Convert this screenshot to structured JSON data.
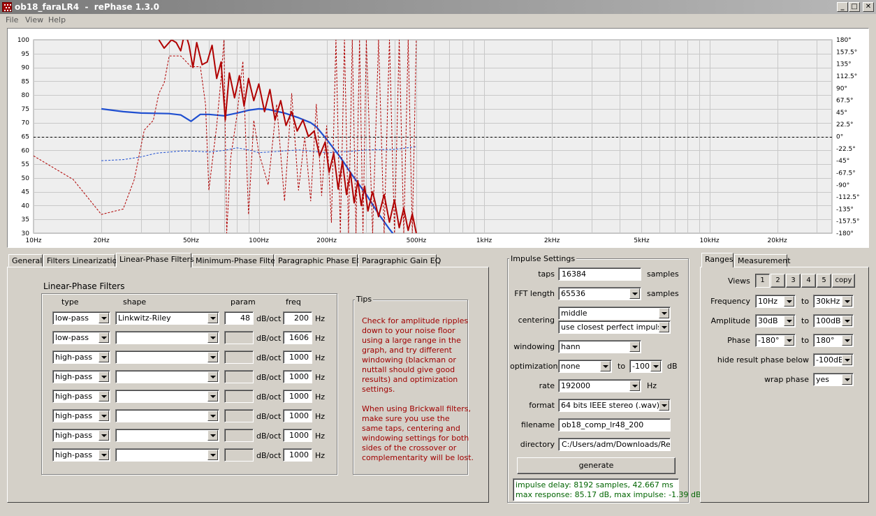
{
  "window": {
    "title": "ob18_faraLR4  -  rePhase 1.3.0",
    "buttons": {
      "minimize": "_",
      "maximize": "□",
      "close": "✕"
    }
  },
  "menu": [
    "File",
    "View",
    "Help"
  ],
  "chart_data": {
    "type": "line",
    "x_scale": "log",
    "xlim": [
      10,
      35000
    ],
    "ylim": [
      30,
      100
    ],
    "y2lim": [
      -180,
      180
    ],
    "x_ticks": [
      {
        "v": 10,
        "label": "10Hz"
      },
      {
        "v": 20,
        "label": "20Hz"
      },
      {
        "v": 50,
        "label": "50Hz"
      },
      {
        "v": 100,
        "label": "100Hz"
      },
      {
        "v": 200,
        "label": "200Hz"
      },
      {
        "v": 500,
        "label": "500Hz"
      },
      {
        "v": 1000,
        "label": "1kHz"
      },
      {
        "v": 2000,
        "label": "2kHz"
      },
      {
        "v": 5000,
        "label": "5kHz"
      },
      {
        "v": 10000,
        "label": "10kHz"
      },
      {
        "v": 20000,
        "label": "20kHz"
      }
    ],
    "y_ticks": [
      100,
      95,
      90,
      85,
      80,
      75,
      70,
      65,
      60,
      55,
      50,
      45,
      40,
      35,
      30
    ],
    "y2_ticks": [
      "180°",
      "157.5°",
      "135°",
      "112.5°",
      "90°",
      "67.5°",
      "45°",
      "22.5°",
      "0°",
      "-22.5°",
      "-45°",
      "-67.5°",
      "-90°",
      "-112.5°",
      "-135°",
      "-157.5°",
      "-180°"
    ],
    "grid": true,
    "colors": {
      "measured": "#b00000",
      "target": "#1f4fd0",
      "zero": "#000000",
      "plot_bg": "#eeeeee"
    },
    "series": [
      {
        "style": "solid-blue",
        "x": [
          20,
          25,
          30,
          35,
          40,
          45,
          50,
          55,
          60,
          70,
          80,
          90,
          100,
          110,
          130,
          150,
          170,
          180,
          200,
          230,
          260,
          300,
          340,
          380,
          420,
          500
        ],
        "y": [
          75,
          74,
          73.5,
          73.4,
          73.3,
          72.8,
          70.5,
          73,
          73,
          72.5,
          73.5,
          74.5,
          75,
          74.8,
          73.5,
          71.8,
          70,
          68.5,
          64,
          57.5,
          51,
          44,
          37,
          31.5,
          27,
          21
        ]
      },
      {
        "style": "dashed-blue",
        "x": [
          20,
          25,
          30,
          35,
          40,
          45,
          50,
          55,
          60,
          70,
          80,
          90,
          100,
          120,
          150,
          200,
          250,
          300,
          400,
          500
        ],
        "y": [
          -45,
          -43,
          -38,
          -31,
          -29,
          -27,
          -27,
          -28,
          -29,
          -26,
          -21,
          -25,
          -30,
          -28,
          -25,
          -30,
          -28,
          -25,
          -24,
          -19
        ]
      },
      {
        "style": "solid-red",
        "x": [
          36,
          38,
          41,
          43,
          45,
          47,
          49,
          51,
          53,
          56,
          59,
          62,
          65,
          68,
          71,
          74,
          78,
          82,
          86,
          90,
          95,
          100,
          106,
          112,
          118,
          125,
          132,
          140,
          148,
          157,
          166,
          176,
          186,
          197,
          205,
          215,
          225,
          235,
          245,
          255,
          265,
          275,
          285,
          295,
          305,
          320,
          340,
          360,
          380,
          400,
          420,
          440,
          460,
          480,
          500
        ],
        "y": [
          100,
          97,
          100,
          99,
          96,
          103,
          98,
          90,
          99,
          91,
          92,
          98,
          86,
          92,
          71,
          88,
          79,
          87,
          76,
          86,
          78,
          84,
          74,
          82,
          71,
          78,
          69,
          74,
          67,
          71,
          65,
          67,
          58,
          63,
          52,
          59,
          46,
          56,
          44,
          52,
          41,
          49,
          40,
          47,
          38,
          45,
          36,
          44,
          34,
          42,
          32,
          39,
          31,
          37,
          30
        ]
      },
      {
        "style": "dashed-red",
        "x": [
          10,
          15,
          20,
          25,
          28,
          31,
          34,
          36,
          38,
          40,
          45,
          50,
          55,
          58,
          60,
          62,
          65,
          68,
          70,
          72,
          75,
          80,
          85,
          90,
          95,
          100,
          110,
          120,
          130,
          140,
          150,
          160,
          170,
          180,
          190,
          200,
          210,
          220,
          230,
          240,
          250,
          260,
          270,
          280,
          290,
          300,
          320,
          340,
          360,
          380,
          400,
          420,
          440,
          460,
          480,
          500
        ],
        "y": [
          -36,
          -80,
          -145,
          -135,
          -80,
          12,
          30,
          80,
          100,
          150,
          150,
          130,
          130,
          60,
          -100,
          -50,
          20,
          110,
          180,
          -180,
          -40,
          40,
          140,
          -145,
          30,
          -30,
          -90,
          60,
          -120,
          80,
          -100,
          0,
          -120,
          60,
          -110,
          20,
          -160,
          180,
          -180,
          180,
          -180,
          180,
          -180,
          180,
          -180,
          180,
          -180,
          180,
          -180,
          180,
          -180,
          180,
          -180,
          180,
          -180,
          180
        ]
      }
    ]
  },
  "tabs_left": [
    "General",
    "Filters Linearization",
    "Linear-Phase Filters",
    "Minimum-Phase Filters",
    "Paragraphic Phase EQ",
    "Paragraphic Gain EQ"
  ],
  "filters": {
    "group_title": "Linear-Phase Filters",
    "headers": {
      "type": "type",
      "shape": "shape",
      "param": "param",
      "freq": "freq"
    },
    "unit_param": "dB/oct",
    "unit_freq": "Hz",
    "rows": [
      {
        "type": "low-pass",
        "shape": "Linkwitz-Riley",
        "param": "48",
        "freq": "200"
      },
      {
        "type": "low-pass",
        "shape": "",
        "param": "",
        "freq": "1606"
      },
      {
        "type": "high-pass",
        "shape": "",
        "param": "",
        "freq": "1000"
      },
      {
        "type": "high-pass",
        "shape": "",
        "param": "",
        "freq": "1000"
      },
      {
        "type": "high-pass",
        "shape": "",
        "param": "",
        "freq": "1000"
      },
      {
        "type": "high-pass",
        "shape": "",
        "param": "",
        "freq": "1000"
      },
      {
        "type": "high-pass",
        "shape": "",
        "param": "",
        "freq": "1000"
      },
      {
        "type": "high-pass",
        "shape": "",
        "param": "",
        "freq": "1000"
      }
    ]
  },
  "tips": {
    "title": "Tips",
    "lines1": [
      "Check for amplitude ripples",
      "down to your noise floor",
      "using a large range in the",
      "graph, and try different",
      "windowing (blackman or",
      "nuttall should give good",
      "results) and optimization",
      "settings."
    ],
    "lines2": [
      "When using Brickwall filters,",
      "make sure you use the",
      "same taps, centering and",
      "windowing settings for both",
      "sides of the crossover or",
      "complementarity will be lost."
    ]
  },
  "impulse": {
    "group_title": "Impulse Settings",
    "taps_label": "taps",
    "taps": "16384",
    "taps_unit": "samples",
    "fft_label": "FFT length",
    "fft": "65536",
    "fft_unit": "samples",
    "centering_label": "centering",
    "centering": "middle",
    "centering2": "use closest perfect impulse",
    "windowing_label": "windowing",
    "windowing": "hann",
    "optimization_label": "optimization",
    "optimization": "none",
    "opt_to": "to",
    "opt_level": "-100",
    "opt_unit": "dB",
    "rate_label": "rate",
    "rate": "192000",
    "rate_unit": "Hz",
    "format_label": "format",
    "format": "64 bits IEEE stereo (.wav)",
    "filename_label": "filename",
    "filename": "ob18_comp_lr48_200",
    "directory_label": "directory",
    "directory": "C:/Users/adm/Downloads/Repha",
    "generate": "generate",
    "status1": "impulse delay: 8192 samples, 42.667 ms",
    "status2": "max response: 85.17 dB, max impulse: -1.39 dB"
  },
  "tabs_right": [
    "Ranges",
    "Measurement"
  ],
  "ranges": {
    "views_label": "Views",
    "views": [
      "1",
      "2",
      "3",
      "4",
      "5"
    ],
    "copy": "copy",
    "to": "to",
    "frequency_label": "Frequency",
    "freq_from": "10Hz",
    "freq_to": "30kHz",
    "amplitude_label": "Amplitude",
    "amp_from": "30dB",
    "amp_to": "100dB",
    "phase_label": "Phase",
    "phase_from": "-180°",
    "phase_to": "180°",
    "hide_label": "hide result phase below",
    "hide_value": "-100dB",
    "wrap_label": "wrap phase",
    "wrap_value": "yes"
  }
}
